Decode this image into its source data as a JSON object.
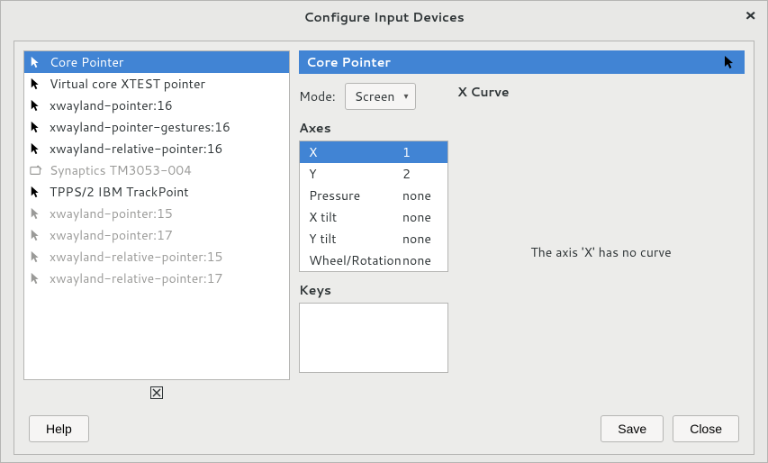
{
  "window": {
    "title": "Configure Input Devices"
  },
  "devices": [
    {
      "name": "Core Pointer",
      "icon": "cursor",
      "selected": true,
      "disabled": false
    },
    {
      "name": "Virtual core XTEST pointer",
      "icon": "cursor",
      "selected": false,
      "disabled": false
    },
    {
      "name": "xwayland-pointer:16",
      "icon": "cursor",
      "selected": false,
      "disabled": false
    },
    {
      "name": "xwayland-pointer-gestures:16",
      "icon": "cursor",
      "selected": false,
      "disabled": false
    },
    {
      "name": "xwayland-relative-pointer:16",
      "icon": "cursor",
      "selected": false,
      "disabled": false
    },
    {
      "name": "Synaptics TM3053-004",
      "icon": "tablet",
      "selected": false,
      "disabled": true
    },
    {
      "name": "TPPS/2 IBM TrackPoint",
      "icon": "cursor",
      "selected": false,
      "disabled": false
    },
    {
      "name": "xwayland-pointer:15",
      "icon": "cursor",
      "selected": false,
      "disabled": true
    },
    {
      "name": "xwayland-pointer:17",
      "icon": "cursor",
      "selected": false,
      "disabled": true
    },
    {
      "name": "xwayland-relative-pointer:15",
      "icon": "cursor",
      "selected": false,
      "disabled": true
    },
    {
      "name": "xwayland-relative-pointer:17",
      "icon": "cursor",
      "selected": false,
      "disabled": true
    }
  ],
  "detail": {
    "title": "Core Pointer",
    "mode_label": "Mode:",
    "mode_value": "Screen",
    "axes_label": "Axes",
    "axes": [
      {
        "name": "X",
        "value": "1",
        "selected": true
      },
      {
        "name": "Y",
        "value": "2",
        "selected": false
      },
      {
        "name": "Pressure",
        "value": "none",
        "selected": false
      },
      {
        "name": "X tilt",
        "value": "none",
        "selected": false
      },
      {
        "name": "Y tilt",
        "value": "none",
        "selected": false
      },
      {
        "name": "Wheel/Rotation",
        "value": "none",
        "selected": false
      }
    ],
    "keys_label": "Keys",
    "curve_title": "X Curve",
    "curve_text": "The axis 'X' has no curve"
  },
  "buttons": {
    "help": "Help",
    "save": "Save",
    "close": "Close"
  }
}
